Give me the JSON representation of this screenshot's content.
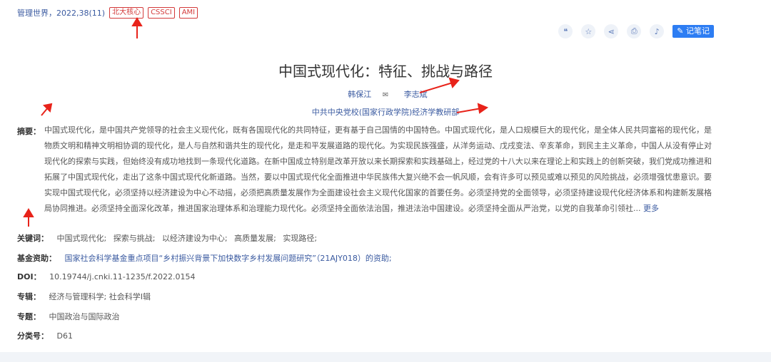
{
  "source": {
    "journal_issue": "管理世界，2022,38(11)",
    "tags": [
      "北大核心",
      "CSSCI",
      "AMI"
    ]
  },
  "tools": {
    "icons": [
      "quote-icon",
      "star-icon",
      "share-icon",
      "print-icon",
      "bell-icon"
    ],
    "note_label": "记笔记"
  },
  "title": "中国式现代化：特征、挑战与路径",
  "authors": [
    "韩保江",
    "李志斌"
  ],
  "organization": "中共中央党校(国家行政学院)经济学教研部",
  "abstract": {
    "label": "摘要：",
    "text": "中国式现代化，是中国共产党领导的社会主义现代化，既有各国现代化的共同特征，更有基于自己国情的中国特色。中国式现代化，是人口规模巨大的现代化，是全体人民共同富裕的现代化，是物质文明和精神文明相协调的现代化，是人与自然和谐共生的现代化，是走和平发展道路的现代化。为实现民族强盛，从洋务运动、戊戌变法、辛亥革命，到民主主义革命，中国人从没有停止对现代化的探索与实践，但始终没有成功地找到一条现代化道路。在新中国成立特别是改革开放以来长期探索和实践基础上，经过党的十八大以来在理论上和实践上的创新突破，我们党成功推进和拓展了中国式现代化，走出了这条中国式现代化新道路。当然，要以中国式现代化全面推进中华民族伟大复兴绝不会一帆风顺，会有许多可以预见或难以预见的风险挑战，必须增强忧患意识。要实现中国式现代化，必须坚持以经济建设为中心不动摇，必须把高质量发展作为全面建设社会主义现代化国家的首要任务。必须坚持党的全面领导，必须坚持建设现代化经济体系和构建新发展格局协同推进。必须坚持全面深化改革，推进国家治理体系和治理能力现代化。必须坚持全面依法治国，推进法治中国建设。必须坚持全面从严治党，以党的自我革命引领社...",
    "more": "更多"
  },
  "keywords": {
    "label": "关键词：",
    "items": [
      "中国式现代化;",
      "探索与挑战;",
      "以经济建设为中心;",
      "高质量发展;",
      "实现路径;"
    ]
  },
  "fund": {
    "label": "基金资助：",
    "value": "国家社会科学基金重点项目“乡村振兴背景下加快数字乡村发展问题研究”（21AJY018）的资助;"
  },
  "doi": {
    "label": "DOI：",
    "value": "10.19744/j.cnki.11-1235/f.2022.0154"
  },
  "series": {
    "label": "专辑：",
    "value": "经济与管理科学; 社会科学Ⅰ辑"
  },
  "topic": {
    "label": "专题：",
    "value": "中国政治与国际政治"
  },
  "classification": {
    "label": "分类号：",
    "value": "D61"
  },
  "colors": {
    "accent": "#2d7df3",
    "link": "#3a5aa0",
    "tag": "#d33a3a",
    "arrow": "#e8231a"
  }
}
